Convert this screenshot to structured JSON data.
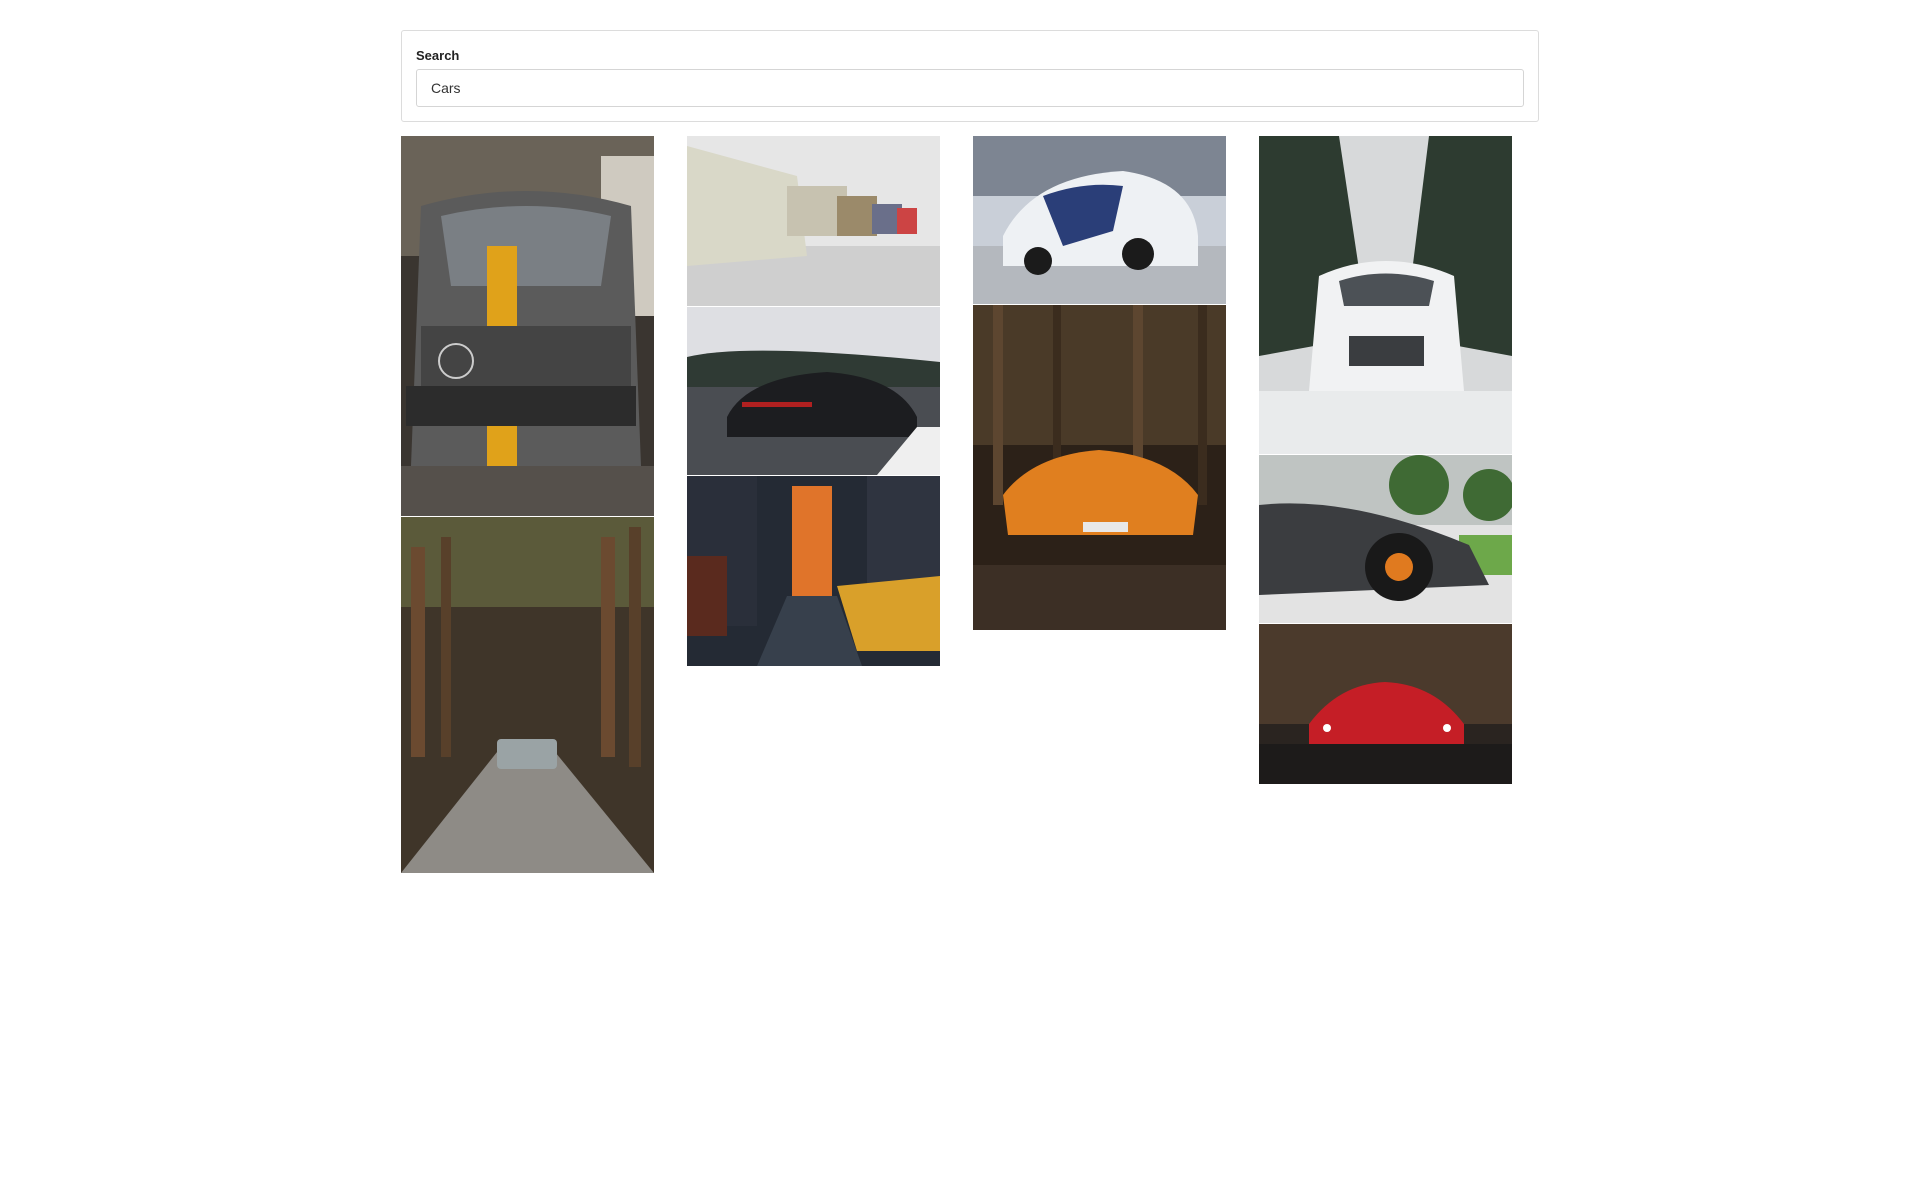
{
  "search": {
    "label": "Search",
    "value": "Cars"
  },
  "gallery": {
    "photos": [
      {
        "subject": "gray-sedan-yellow-stripe"
      },
      {
        "subject": "car-on-forest-road"
      },
      {
        "subject": "vintage-cars-row"
      },
      {
        "subject": "black-sports-sedan-highway"
      },
      {
        "subject": "city-street-taxis-sunset"
      },
      {
        "subject": "white-muscle-car-blue-stripes"
      },
      {
        "subject": "orange-supercar-forest"
      },
      {
        "subject": "white-suv-snowy-road"
      },
      {
        "subject": "gray-supercar-side"
      },
      {
        "subject": "red-sports-car-dark"
      }
    ]
  }
}
